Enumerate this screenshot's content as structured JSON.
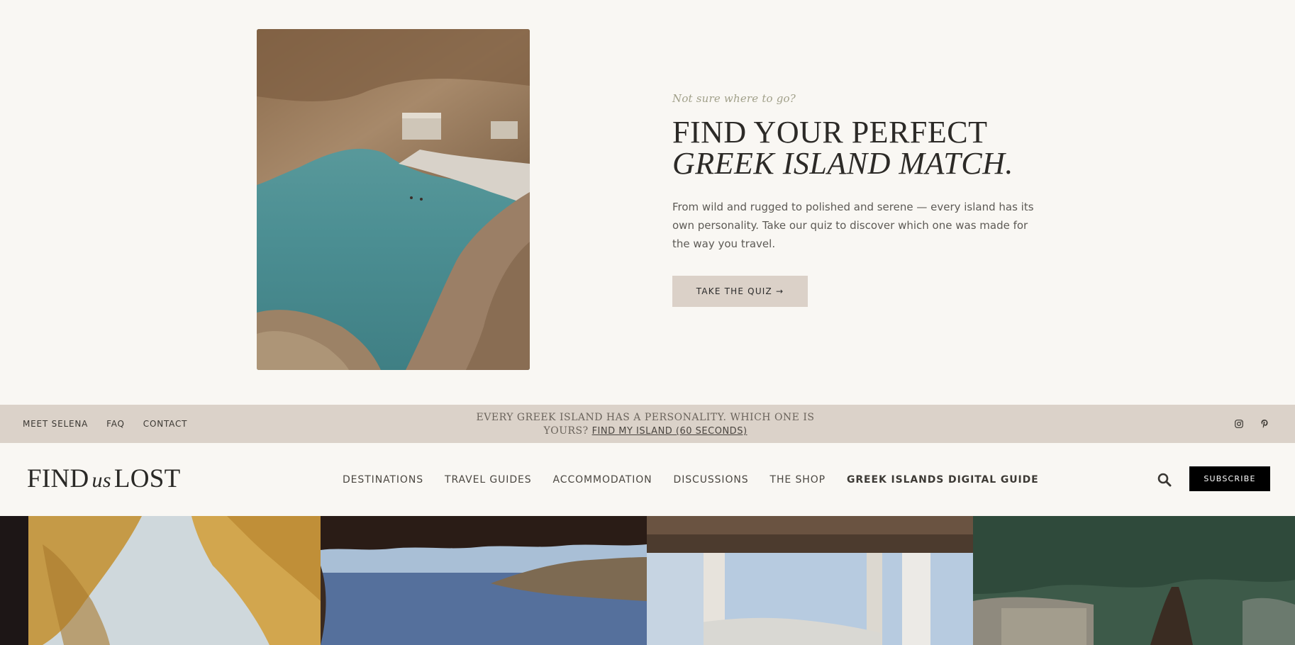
{
  "hero": {
    "eyebrow": "Not sure where to go?",
    "headline_line1": "FIND YOUR PERFECT",
    "headline_line2": "GREEK ISLAND MATCH.",
    "body": "From wild and rugged to polished and serene — every island has its own personality. Take our quiz to discover which one was made for the way you travel.",
    "cta_label": "TAKE THE QUIZ →"
  },
  "announcement": {
    "util_links": [
      "MEET SELENA",
      "FAQ",
      "CONTACT"
    ],
    "message": "EVERY GREEK ISLAND HAS A PERSONALITY. WHICH ONE IS YOURS?",
    "link_label": "FIND MY ISLAND (60 SECONDS)",
    "social_icons": [
      "instagram-icon",
      "pinterest-icon"
    ]
  },
  "nav": {
    "logo_left": "FIND",
    "logo_mid": "us",
    "logo_right": "LOST",
    "items": [
      "DESTINATIONS",
      "TRAVEL GUIDES",
      "ACCOMMODATION",
      "DISCUSSIONS",
      "THE SHOP",
      "GREEK ISLANDS DIGITAL GUIDE"
    ],
    "subscribe_label": "SUBSCRIBE"
  },
  "colors": {
    "background": "#f9f7f3",
    "accent_beige": "#dbd2c9",
    "button_black": "#000000"
  }
}
